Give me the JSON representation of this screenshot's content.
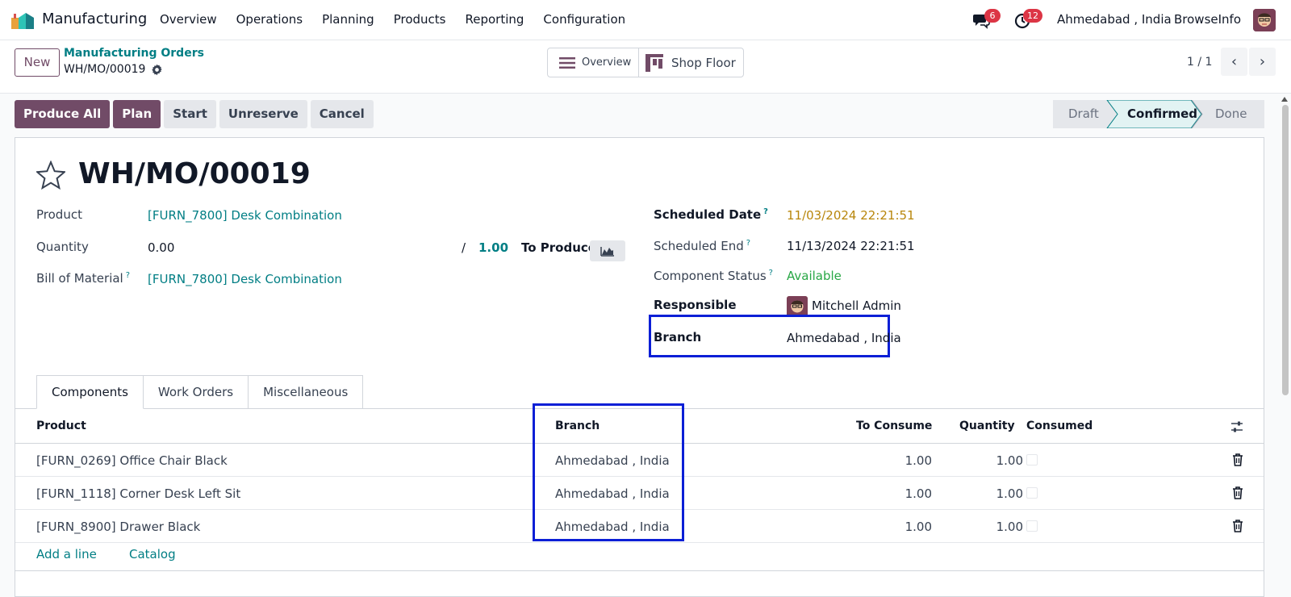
{
  "navbar": {
    "app_name": "Manufacturing",
    "menu": [
      "Overview",
      "Operations",
      "Planning",
      "Products",
      "Reporting",
      "Configuration"
    ],
    "messages_badge": "6",
    "activities_badge": "12",
    "branch": "Ahmedabad , India",
    "company": "BrowseInfo"
  },
  "control": {
    "new_label": "New",
    "breadcrumb_parent": "Manufacturing Orders",
    "breadcrumb_current": "WH/MO/00019",
    "overview_label": "Overview",
    "shop_floor_label": "Shop Floor",
    "pager": "1 / 1"
  },
  "actions": [
    "Produce All",
    "Plan",
    "Start",
    "Unreserve",
    "Cancel"
  ],
  "stages": {
    "draft": "Draft",
    "confirmed": "Confirmed",
    "done": "Done",
    "active": "Confirmed"
  },
  "form": {
    "title": "WH/MO/00019",
    "product_label": "Product",
    "product_value": "[FURN_7800] Desk Combination",
    "quantity_label": "Quantity",
    "quantity_value": "0.00",
    "quantity_sep": "/",
    "quantity_target": "1.00",
    "to_produce_label": "To Produce",
    "bom_label": "Bill of Material",
    "bom_value": "[FURN_7800] Desk Combination",
    "help_mark": "?",
    "scheduled_date_label": "Scheduled Date",
    "scheduled_date_value": "11/03/2024 22:21:51",
    "scheduled_end_label": "Scheduled End",
    "scheduled_end_value": "11/13/2024 22:21:51",
    "component_status_label": "Component Status",
    "component_status_value": "Available",
    "responsible_label": "Responsible",
    "responsible_value": "Mitchell Admin",
    "branch_label": "Branch",
    "branch_value": "Ahmedabad , India"
  },
  "tabs": [
    "Components",
    "Work Orders",
    "Miscellaneous"
  ],
  "table": {
    "headers": {
      "product": "Product",
      "branch": "Branch",
      "to_consume": "To Consume",
      "quantity": "Quantity",
      "consumed": "Consumed"
    },
    "rows": [
      {
        "product": "[FURN_0269] Office Chair Black",
        "branch": "Ahmedabad , India",
        "to_consume": "1.00",
        "quantity": "1.00"
      },
      {
        "product": "[FURN_1118] Corner Desk Left Sit",
        "branch": "Ahmedabad , India",
        "to_consume": "1.00",
        "quantity": "1.00"
      },
      {
        "product": "[FURN_8900] Drawer Black",
        "branch": "Ahmedabad , India",
        "to_consume": "1.00",
        "quantity": "1.00"
      }
    ],
    "add_line": "Add a line",
    "catalog": "Catalog"
  },
  "colors": {
    "brand": "#714b67",
    "link": "#017e84",
    "highlight": "#0b1fd6",
    "badge": "#dc3545"
  }
}
